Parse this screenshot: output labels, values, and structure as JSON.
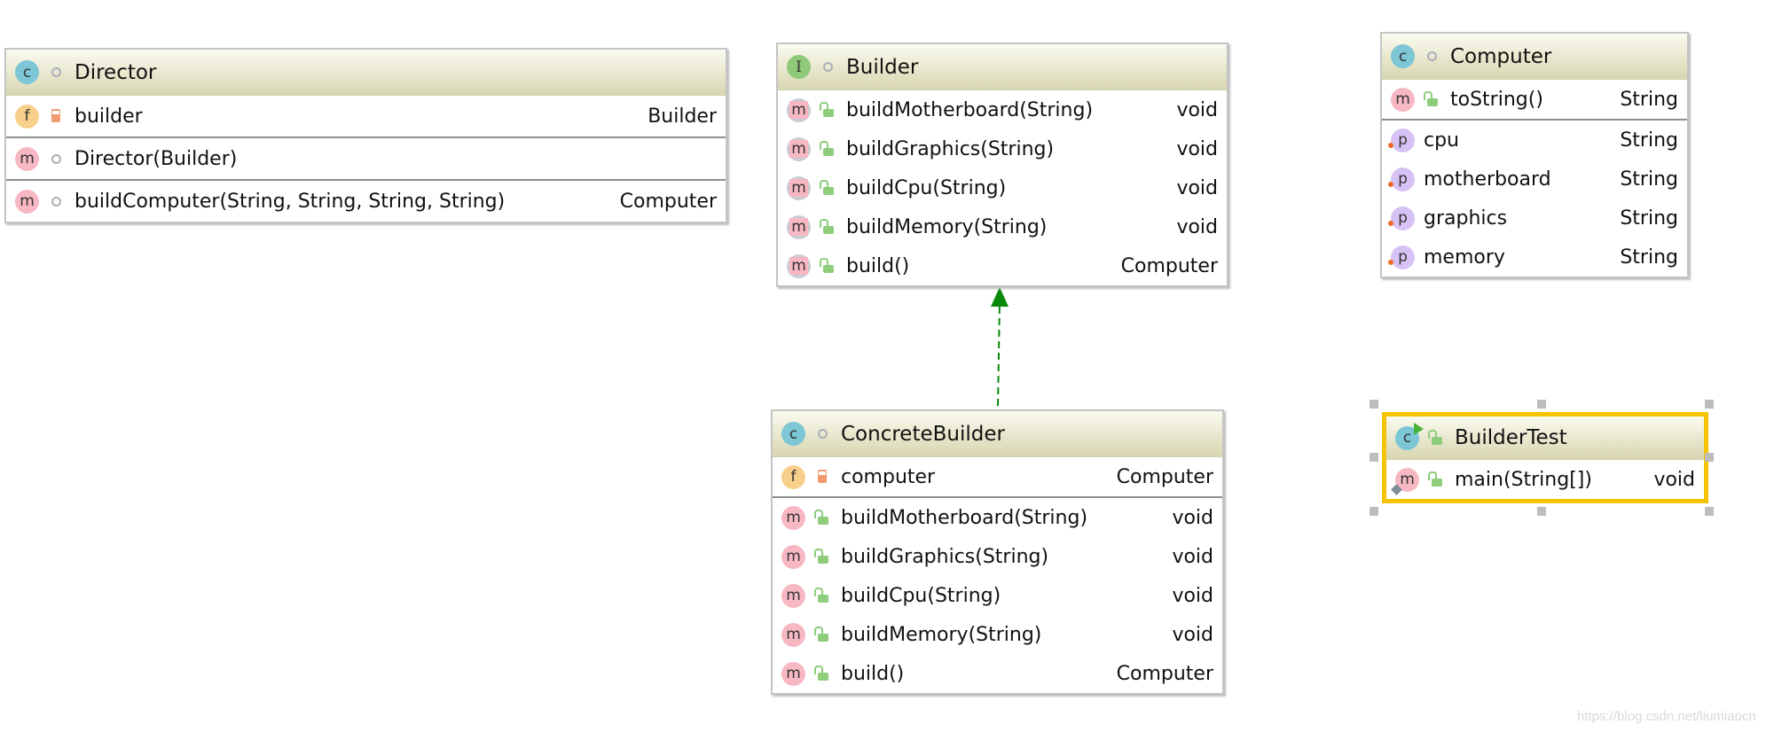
{
  "classes": [
    {
      "id": "director",
      "kind": "c",
      "visibility": "pkg",
      "name": "Director",
      "sections": [
        [
          {
            "icon": "f",
            "visibility": "priv",
            "name": "builder",
            "type": "Builder"
          }
        ],
        [
          {
            "icon": "m",
            "visibility": "pkg",
            "name": "Director(Builder)",
            "type": ""
          }
        ],
        [
          {
            "icon": "m",
            "visibility": "pkg",
            "name": "buildComputer(String, String, String, String)",
            "type": "Computer"
          }
        ]
      ]
    },
    {
      "id": "builder",
      "kind": "i",
      "visibility": "pkg",
      "name": "Builder",
      "sections": [
        [
          {
            "icon": "am",
            "visibility": "pub",
            "name": "buildMotherboard(String)",
            "type": "void"
          },
          {
            "icon": "am",
            "visibility": "pub",
            "name": "buildGraphics(String)",
            "type": "void"
          },
          {
            "icon": "am",
            "visibility": "pub",
            "name": "buildCpu(String)",
            "type": "void"
          },
          {
            "icon": "am",
            "visibility": "pub",
            "name": "buildMemory(String)",
            "type": "void"
          },
          {
            "icon": "am",
            "visibility": "pub",
            "name": "build()",
            "type": "Computer"
          }
        ]
      ]
    },
    {
      "id": "computer",
      "kind": "c",
      "visibility": "pkg",
      "name": "Computer",
      "sections": [
        [
          {
            "icon": "m",
            "visibility": "pub",
            "name": "toString()",
            "type": "String"
          }
        ],
        [
          {
            "icon": "p",
            "visibility": "",
            "name": "cpu",
            "type": "String"
          },
          {
            "icon": "p",
            "visibility": "",
            "name": "motherboard",
            "type": "String"
          },
          {
            "icon": "p",
            "visibility": "",
            "name": "graphics",
            "type": "String"
          },
          {
            "icon": "p",
            "visibility": "",
            "name": "memory",
            "type": "String"
          }
        ]
      ]
    },
    {
      "id": "concrete",
      "kind": "c",
      "visibility": "pkg",
      "name": "ConcreteBuilder",
      "sections": [
        [
          {
            "icon": "f",
            "visibility": "priv",
            "name": "computer",
            "type": "Computer"
          }
        ],
        [
          {
            "icon": "m",
            "visibility": "pub",
            "name": "buildMotherboard(String)",
            "type": "void"
          },
          {
            "icon": "m",
            "visibility": "pub",
            "name": "buildGraphics(String)",
            "type": "void"
          },
          {
            "icon": "m",
            "visibility": "pub",
            "name": "buildCpu(String)",
            "type": "void"
          },
          {
            "icon": "m",
            "visibility": "pub",
            "name": "buildMemory(String)",
            "type": "void"
          },
          {
            "icon": "m",
            "visibility": "pub",
            "name": "build()",
            "type": "Computer"
          }
        ]
      ]
    },
    {
      "id": "buildertest",
      "kind": "c run",
      "visibility": "pub",
      "name": "BuilderTest",
      "selected": true,
      "sections": [
        [
          {
            "icon": "m mainm",
            "visibility": "pub",
            "name": "main(String[])",
            "type": "void"
          }
        ]
      ]
    }
  ],
  "relations": [
    {
      "from": "ConcreteBuilder",
      "to": "Builder",
      "type": "realization",
      "color": "#0a8a0a"
    }
  ],
  "selection_color": "#f5c400",
  "watermark": "https://blog.csdn.net/liumiaocn"
}
